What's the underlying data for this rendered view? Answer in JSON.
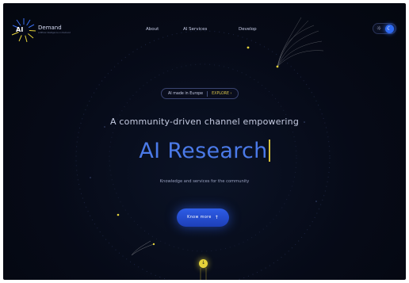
{
  "brand": {
    "logo_mark": "AI",
    "logo_word": "Demand",
    "logo_sub": "Artificial Intelligence on Demand"
  },
  "nav": {
    "items": [
      {
        "label": "About"
      },
      {
        "label": "AI Services"
      },
      {
        "label": "Develop"
      }
    ]
  },
  "theme_toggle": {
    "sun_icon": "☼",
    "moon_icon": "☾",
    "active": "dark"
  },
  "announcement": {
    "text": "AI made in Europe",
    "link_label": "EXPLORE ›"
  },
  "hero": {
    "tagline": "A community-driven channel empowering",
    "headline": "AI Research",
    "subtitle": "Knowledge and services for the community"
  },
  "cta": {
    "label": "Know more",
    "arrow": "↑"
  },
  "scroll_indicator": {
    "icon": "↓"
  },
  "colors": {
    "background": "#060a17",
    "accent_blue": "#2e5de6",
    "accent_yellow": "#e6d43a",
    "headline": "#4b7ae8"
  }
}
